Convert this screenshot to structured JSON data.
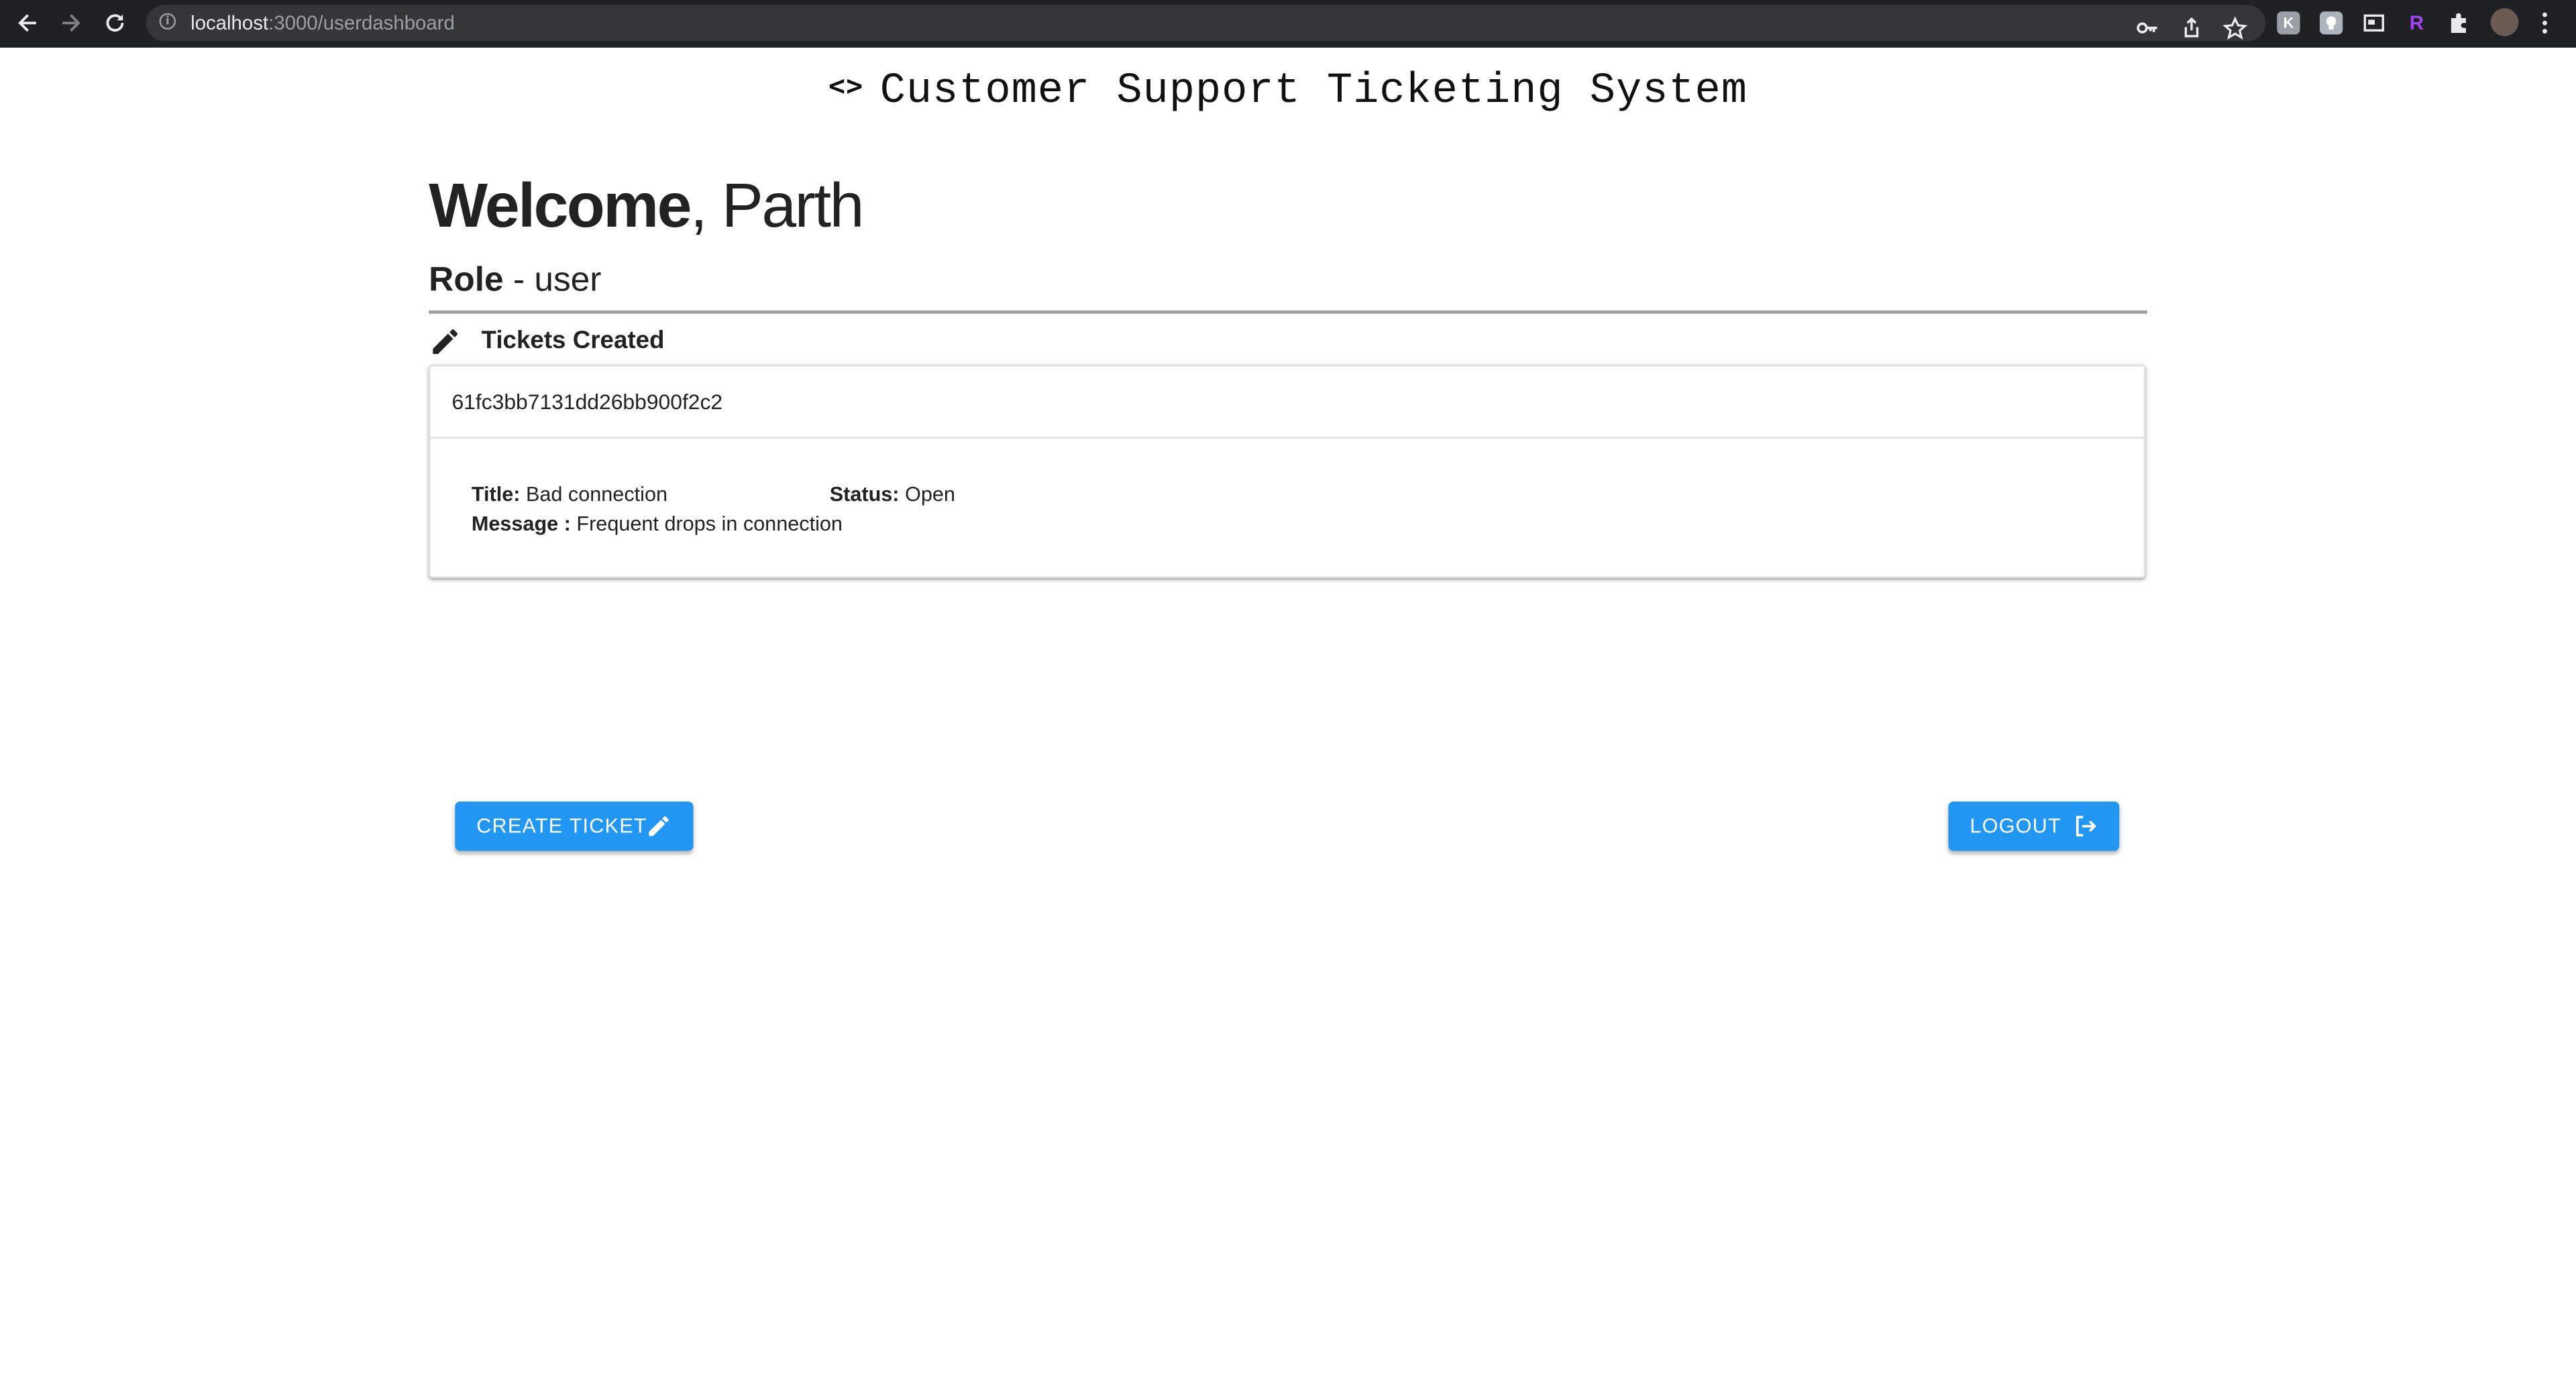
{
  "browser": {
    "url_host": "localhost",
    "url_path": ":3000/userdashboard",
    "extension_letter": "R"
  },
  "site": {
    "title": "Customer Support Ticketing System",
    "title_icon": "<>"
  },
  "welcome": {
    "greeting": "Welcome",
    "name": ", Parth"
  },
  "role": {
    "label": "Role",
    "value": " - user"
  },
  "tickets_section": {
    "heading": "Tickets Created",
    "tickets": [
      {
        "id": "61fc3bb7131dd26bb900f2c2",
        "title_label": "Title:",
        "title": " Bad connection",
        "status_label": "Status:",
        "status": " Open",
        "message_label": "Message :",
        "message": " Frequent drops in connection"
      }
    ]
  },
  "actions": {
    "create_ticket": "CREATE TICKET",
    "logout": "LOGOUT"
  },
  "colors": {
    "primary": "#2196f3",
    "chrome_bg": "#202124"
  }
}
